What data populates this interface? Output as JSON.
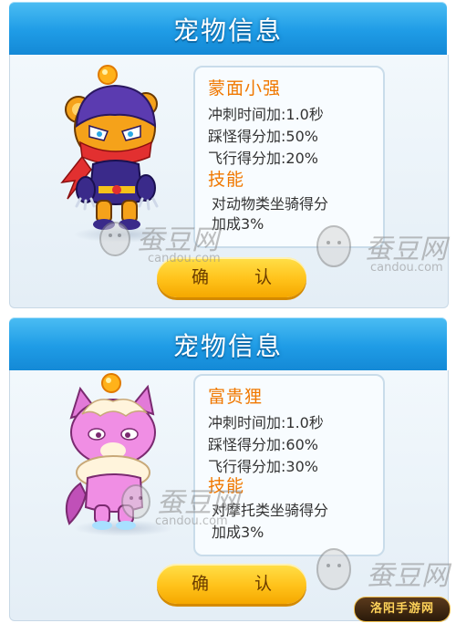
{
  "panels": [
    {
      "title": "宠物信息",
      "pet_name": "蒙面小强",
      "stats": [
        "冲刺时间加:1.0秒",
        "踩怪得分加:50%",
        "飞行得分加:20%"
      ],
      "skill_title": "技能",
      "skill_lines": [
        "对动物类坐骑得分",
        "加成3%"
      ],
      "confirm_label": "确 认",
      "character": "masked-bear-ninja"
    },
    {
      "title": "宠物信息",
      "pet_name": "富贵狸",
      "stats": [
        "冲刺时间加:1.0秒",
        "踩怪得分加:60%",
        "飞行得分加:30%"
      ],
      "skill_title": "技能",
      "skill_lines": [
        "对摩托类坐骑得分",
        "加成3%"
      ],
      "confirm_label": "确 认",
      "character": "pink-raccoon"
    }
  ],
  "watermark": {
    "text": "蚕豆网",
    "url": "candou.com"
  },
  "corner_logo": "洛阳手游网",
  "colors": {
    "header_blue": "#1f9ce6",
    "name_orange": "#f07800",
    "button_yellow": "#ffc21a",
    "stat_text": "#333333"
  }
}
